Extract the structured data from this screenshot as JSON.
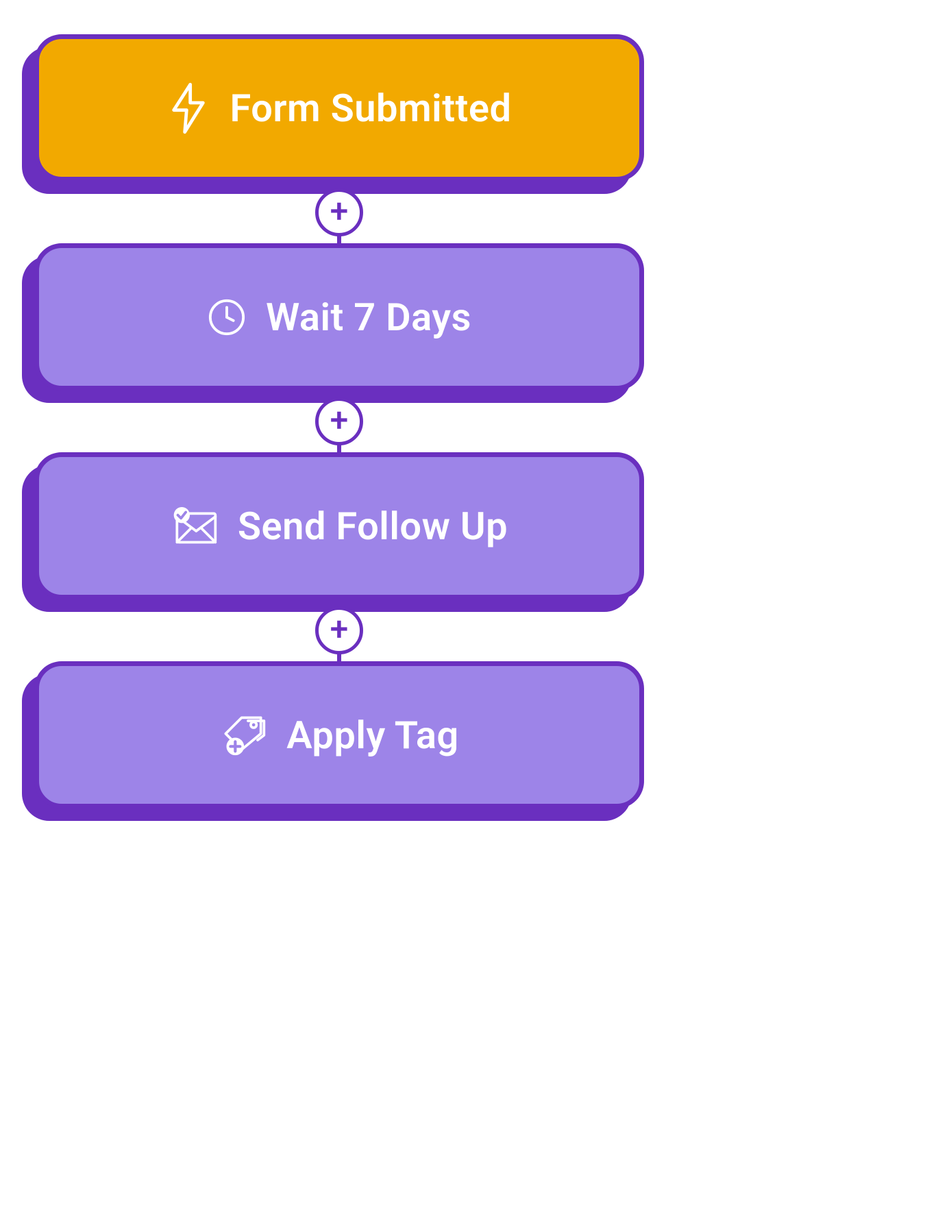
{
  "flow": {
    "nodes": [
      {
        "label": "Form Submitted",
        "icon": "lightning-icon",
        "type": "trigger"
      },
      {
        "label": "Wait 7 Days",
        "icon": "clock-icon",
        "type": "action"
      },
      {
        "label": "Send Follow Up",
        "icon": "mail-check-icon",
        "type": "action"
      },
      {
        "label": "Apply Tag",
        "icon": "tag-plus-icon",
        "type": "action"
      }
    ],
    "add_button_glyph": "+"
  },
  "colors": {
    "trigger_bg": "#f2a900",
    "action_bg": "#9d84e8",
    "border": "#6a2fbf",
    "shadow": "#6a2fbf",
    "plus_bg": "#ffffff",
    "text": "#ffffff"
  }
}
